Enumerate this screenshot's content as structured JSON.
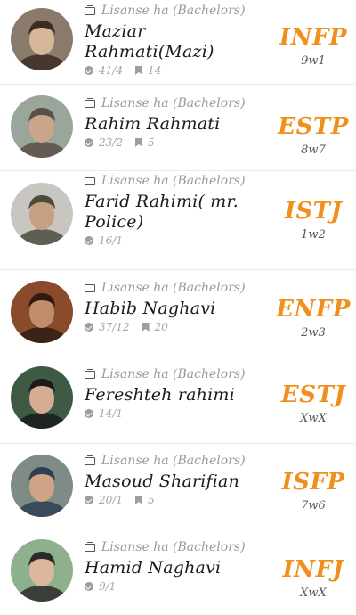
{
  "characters": [
    {
      "subtitle": "Lisanse ha (Bachelors)",
      "name": "Maziar Rahmati(Mazi)",
      "votes": "41/4",
      "comments": "14",
      "mbti": "INFP",
      "enneagram": "9w1",
      "avatar_colors": [
        "#8a7a6c",
        "#3b2b22",
        "#d7b79a"
      ]
    },
    {
      "subtitle": "Lisanse ha (Bachelors)",
      "name": "Rahim Rahmati",
      "votes": "23/2",
      "comments": "5",
      "mbti": "ESTP",
      "enneagram": "8w7",
      "avatar_colors": [
        "#9aa69a",
        "#5a4e45",
        "#caa58a"
      ]
    },
    {
      "subtitle": "Lisanse ha (Bachelors)",
      "name": "Farid Rahimi( mr. Police)",
      "votes": "16/1",
      "comments": "",
      "mbti": "ISTJ",
      "enneagram": "1w2",
      "avatar_colors": [
        "#c9c6c1",
        "#4a4c3c",
        "#c79f83"
      ]
    },
    {
      "subtitle": "Lisanse ha (Bachelors)",
      "name": "Habib Naghavi",
      "votes": "37/12",
      "comments": "20",
      "mbti": "ENFP",
      "enneagram": "2w3",
      "avatar_colors": [
        "#8a4a2c",
        "#2e1c14",
        "#c28d6b"
      ]
    },
    {
      "subtitle": "Lisanse ha (Bachelors)",
      "name": "Fereshteh rahimi",
      "votes": "14/1",
      "comments": "",
      "mbti": "ESTJ",
      "enneagram": "XwX",
      "avatar_colors": [
        "#3e5a44",
        "#1b1b1b",
        "#d5ad94"
      ]
    },
    {
      "subtitle": "Lisanse ha (Bachelors)",
      "name": "Masoud Sharifian",
      "votes": "20/1",
      "comments": "5",
      "mbti": "ISFP",
      "enneagram": "7w6",
      "avatar_colors": [
        "#7f8c86",
        "#2f3e52",
        "#cfa486"
      ]
    },
    {
      "subtitle": "Lisanse ha (Bachelors)",
      "name": "Hamid Naghavi",
      "votes": "9/1",
      "comments": "",
      "mbti": "INFJ",
      "enneagram": "XwX",
      "avatar_colors": [
        "#8fb08c",
        "#2a2a2a",
        "#dcb79c"
      ]
    }
  ],
  "colors": {
    "type_accent": "#f0901c",
    "subtitle": "#9a9a9a",
    "name": "#1c1c1c",
    "divider": "#ececec"
  }
}
